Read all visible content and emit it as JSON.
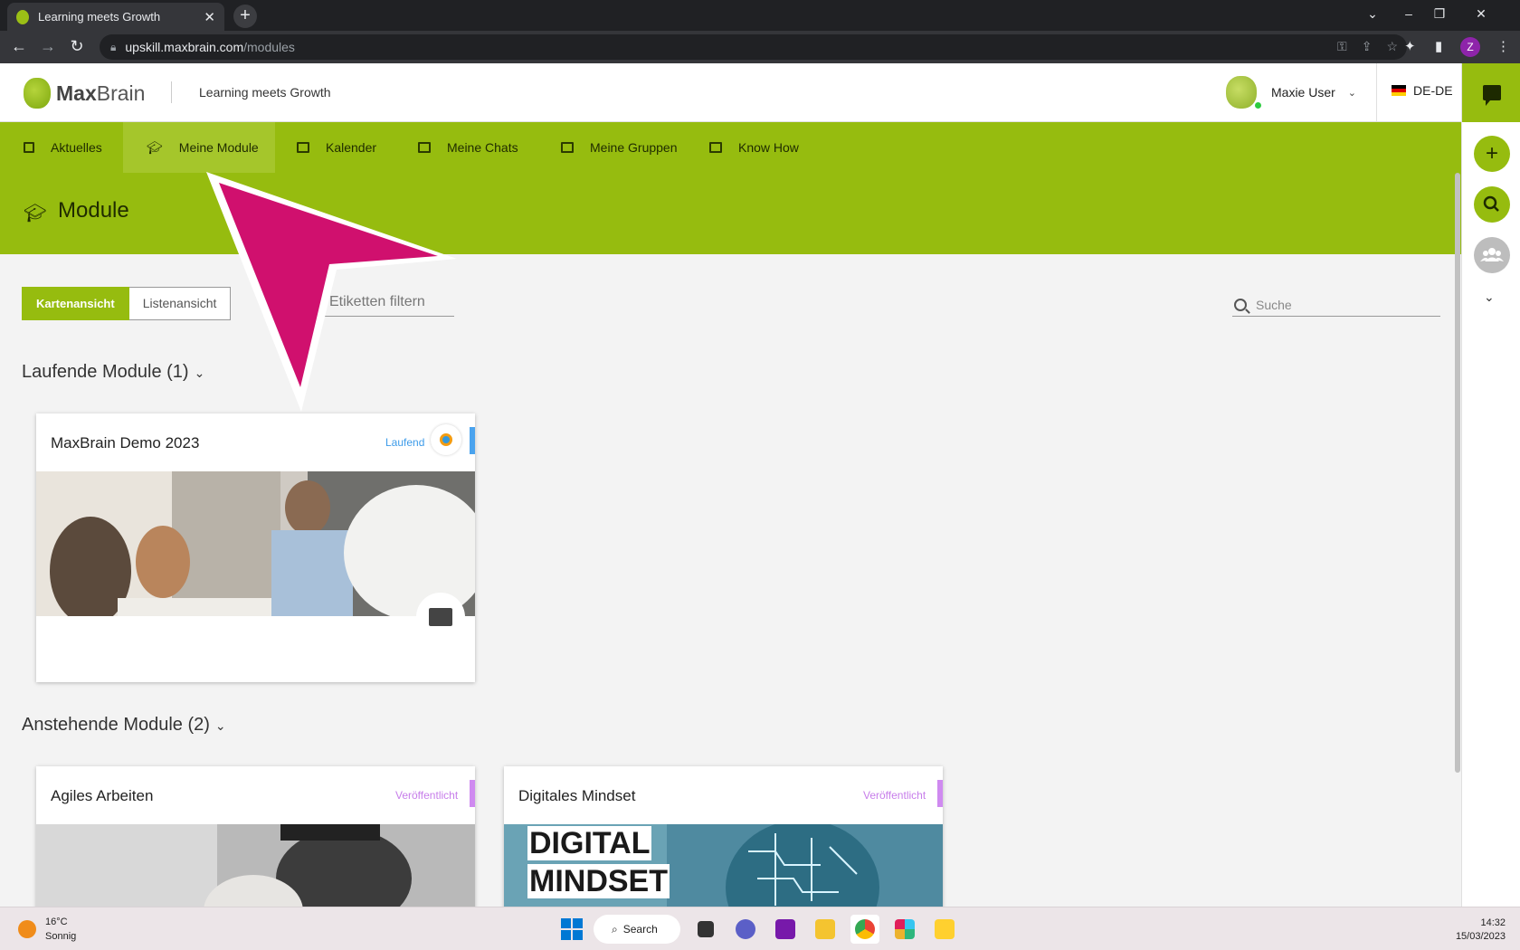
{
  "browser": {
    "tab_title": "Learning meets Growth",
    "url_host": "upskill.maxbrain.com",
    "url_path": "/modules",
    "profile_initial": "Z"
  },
  "header": {
    "logo_bold": "Max",
    "logo_light": "Brain",
    "tagline": "Learning meets Growth",
    "user_name": "Maxie User",
    "language": "DE-DE"
  },
  "nav": {
    "items": [
      {
        "label": "Aktuelles"
      },
      {
        "label": "Meine Module"
      },
      {
        "label": "Kalender"
      },
      {
        "label": "Meine Chats"
      },
      {
        "label": "Meine Gruppen"
      },
      {
        "label": "Know How"
      }
    ],
    "active": "Meine Module"
  },
  "page": {
    "title": "Module",
    "view_card": "Kartenansicht",
    "view_list": "Listenansicht",
    "filter_placeholder": "Etiketten filtern",
    "search_placeholder": "Suche"
  },
  "sections": {
    "running": {
      "title": "Laufende Module (1)",
      "cards": [
        {
          "title": "MaxBrain Demo 2023",
          "status": "Laufend",
          "status_color": "#3d9be9"
        }
      ]
    },
    "upcoming": {
      "title": "Anstehende Module (2)",
      "cards": [
        {
          "title": "Agiles Arbeiten",
          "status": "Veröffentlicht",
          "status_color": "#c77dea"
        },
        {
          "title": "Digitales Mindset",
          "status": "Veröffentlicht",
          "status_color": "#c77dea",
          "image_text_1": "DIGITAL",
          "image_text_2": "MINDSET"
        }
      ]
    }
  },
  "taskbar": {
    "temperature": "16°C",
    "weather": "Sonnig",
    "search_label": "Search",
    "time": "14:32",
    "date": "15/03/2023"
  },
  "colors": {
    "brand_green": "#96bc0f",
    "annotation_arrow": "#d0106e"
  }
}
